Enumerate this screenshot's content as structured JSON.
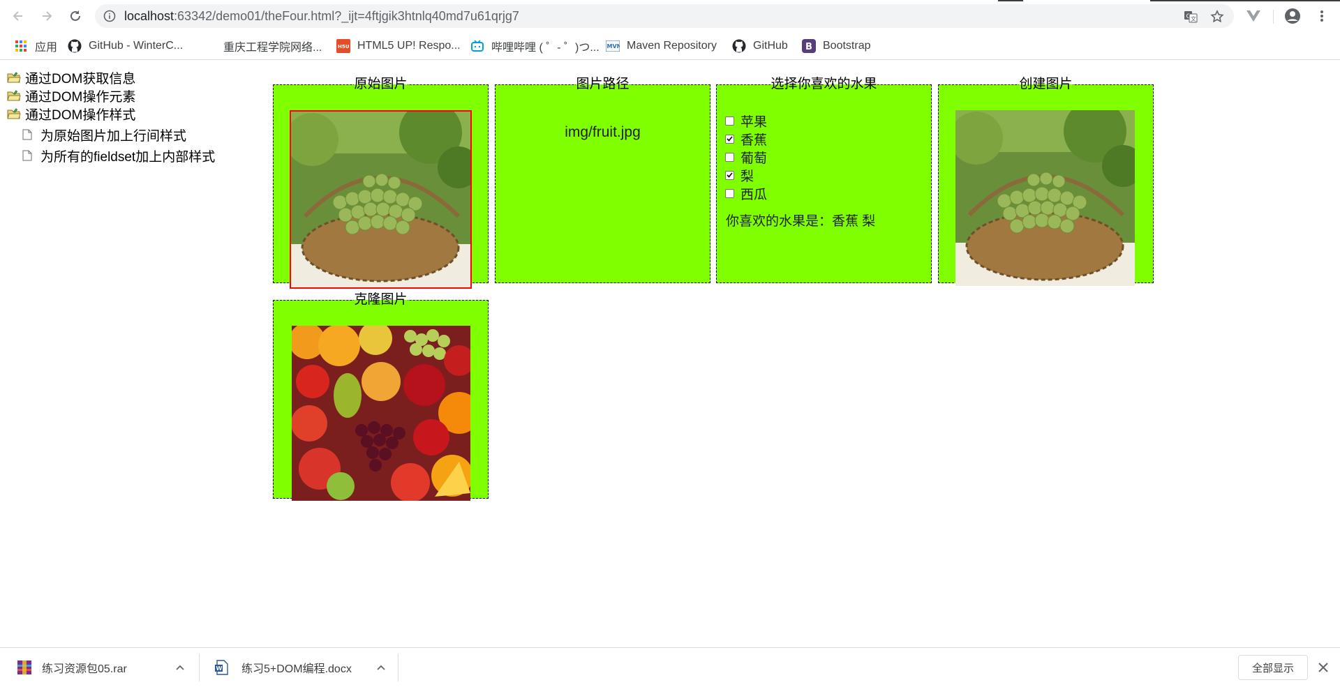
{
  "browser": {
    "url_host": "localhost",
    "url_rest": ":63342/demo01/theFour.html?_ijt=4ftjgik3htnlq40md7u61qrjg7"
  },
  "bookmarks": [
    {
      "label": "应用",
      "icon": "apps-grid-icon"
    },
    {
      "label": "GitHub - WinterC...",
      "icon": "github-icon"
    },
    {
      "label": "重庆工程学院网络...",
      "icon": "none"
    },
    {
      "label": "HTML5 UP! Respo...",
      "icon": "html5up-icon"
    },
    {
      "label": "哔哩哔哩 ( ゜- ゜)つ...",
      "icon": "bilibili-icon"
    },
    {
      "label": "Maven Repository",
      "icon": "maven-icon"
    },
    {
      "label": "GitHub",
      "icon": "github-icon"
    },
    {
      "label": "Bootstrap",
      "icon": "bootstrap-icon"
    }
  ],
  "tree": {
    "items": [
      {
        "label": "通过DOM获取信息"
      },
      {
        "label": "通过DOM操作元素"
      },
      {
        "label": "通过DOM操作样式"
      }
    ],
    "children": [
      {
        "label": "为原始图片加上行间样式"
      },
      {
        "label": "为所有的fieldset加上内部样式"
      }
    ]
  },
  "panels": {
    "original": {
      "legend": "原始图片"
    },
    "path": {
      "legend": "图片路径",
      "value": "img/fruit.jpg"
    },
    "fruits": {
      "legend": "选择你喜欢的水果",
      "options": [
        {
          "label": "苹果",
          "checked": false
        },
        {
          "label": "香蕉",
          "checked": true
        },
        {
          "label": "葡萄",
          "checked": false
        },
        {
          "label": "梨",
          "checked": true
        },
        {
          "label": "西瓜",
          "checked": false
        }
      ],
      "result": "你喜欢的水果是：香蕉 梨"
    },
    "created": {
      "legend": "创建图片"
    },
    "cloned": {
      "legend": "克隆图片"
    }
  },
  "downloads": {
    "items": [
      {
        "name": "练习资源包05.rar",
        "icon": "winrar-icon"
      },
      {
        "name": "练习5+DOM编程.docx",
        "icon": "word-doc-icon"
      }
    ],
    "show_all": "全部显示"
  },
  "colors": {
    "panel_bg": "#7fff00",
    "original_border": "#ff0000"
  }
}
